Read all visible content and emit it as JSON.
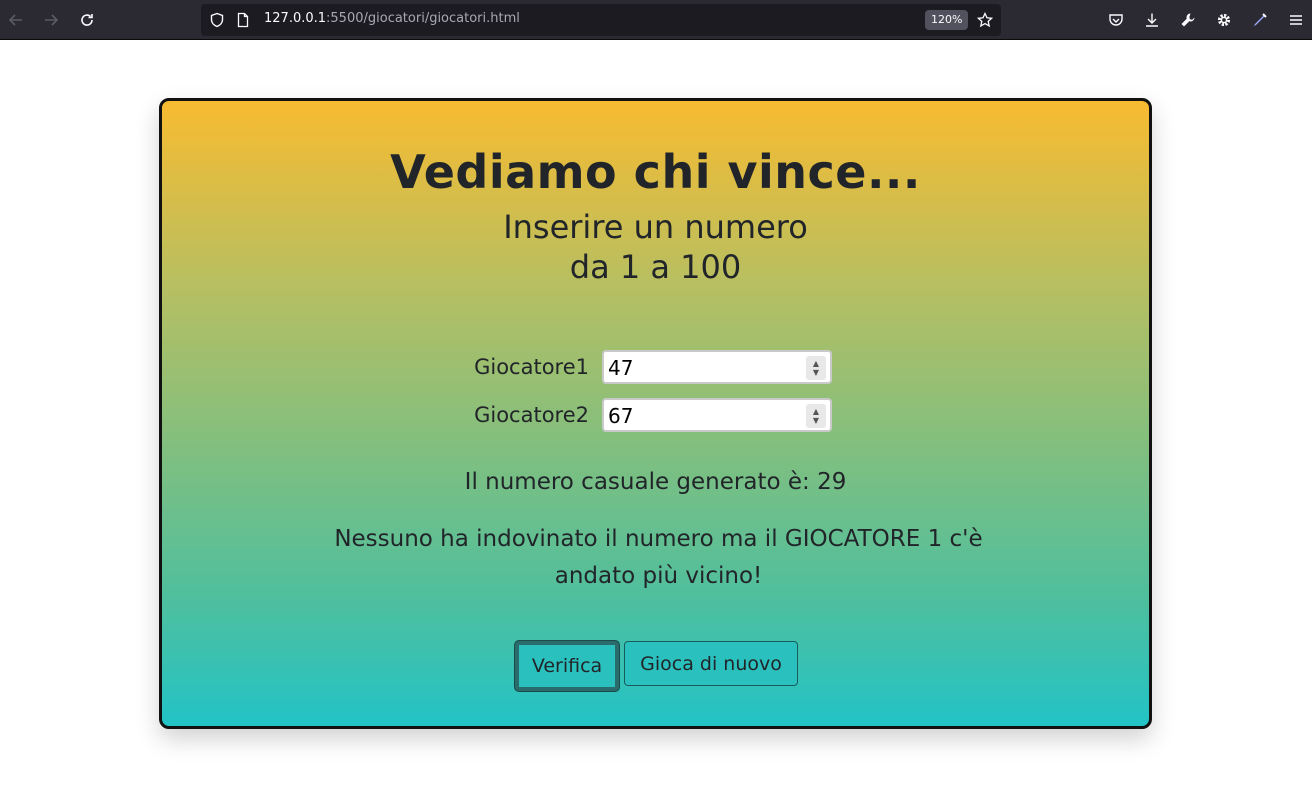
{
  "browser": {
    "url_host": "127.0.0.1",
    "url_rest": ":5500/giocatori/giocatori.html",
    "zoom": "120%"
  },
  "page": {
    "title": "Vediamo chi vince...",
    "subtitle_line1": "Inserire un numero",
    "subtitle_line2": "da 1 a 100",
    "players": [
      {
        "label": "Giocatore1",
        "value": "47"
      },
      {
        "label": "Giocatore2",
        "value": "67"
      }
    ],
    "result_text": "Il numero casuale generato è: 29",
    "message_text": "Nessuno ha indovinato il numero ma il GIOCATORE 1 c'è andato più vicino!",
    "verify_button": "Verifica",
    "retry_button": "Gioca di nuovo"
  },
  "colors": {
    "gradient_top": "#f8bb30",
    "gradient_bottom": "#22c3c7",
    "text": "#212529"
  }
}
